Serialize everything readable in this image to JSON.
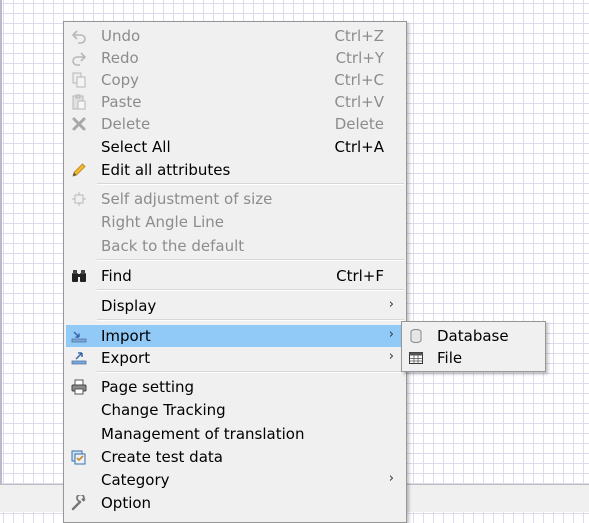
{
  "context_menu": {
    "undo": {
      "label": "Undo",
      "shortcut": "Ctrl+Z",
      "icon": "undo-icon"
    },
    "redo": {
      "label": "Redo",
      "shortcut": "Ctrl+Y",
      "icon": "redo-icon"
    },
    "copy": {
      "label": "Copy",
      "shortcut": "Ctrl+C",
      "icon": "copy-icon"
    },
    "paste": {
      "label": "Paste",
      "shortcut": "Ctrl+V",
      "icon": "paste-icon"
    },
    "delete": {
      "label": "Delete",
      "shortcut": "Delete",
      "icon": "delete-icon"
    },
    "select_all": {
      "label": "Select All",
      "shortcut": "Ctrl+A"
    },
    "edit_all_attributes": {
      "label": "Edit all attributes",
      "icon": "pencil-icon"
    },
    "self_adjustment": {
      "label": "Self adjustment of size",
      "icon": "resize-icon"
    },
    "right_angle_line": {
      "label": "Right Angle Line"
    },
    "back_to_default": {
      "label": "Back to the default"
    },
    "find": {
      "label": "Find",
      "shortcut": "Ctrl+F",
      "icon": "binoculars-icon"
    },
    "display": {
      "label": "Display",
      "submenu_arrow": "›"
    },
    "import": {
      "label": "Import",
      "submenu_arrow": "›",
      "icon": "import-icon"
    },
    "export": {
      "label": "Export",
      "submenu_arrow": "›",
      "icon": "export-icon"
    },
    "page_setting": {
      "label": "Page setting",
      "icon": "printer-icon"
    },
    "change_tracking": {
      "label": "Change Tracking"
    },
    "management_of_translation": {
      "label": "Management of translation"
    },
    "create_test_data": {
      "label": "Create test data",
      "icon": "test-data-icon"
    },
    "category": {
      "label": "Category",
      "submenu_arrow": "›"
    },
    "option": {
      "label": "Option",
      "icon": "wrench-icon"
    }
  },
  "import_submenu": {
    "database": {
      "label": "Database",
      "icon": "database-icon"
    },
    "file": {
      "label": "File",
      "icon": "table-file-icon"
    }
  },
  "colors": {
    "highlight": "#91c9f7",
    "menu_background": "#f0f0f0",
    "disabled_text": "#8c8c8c"
  }
}
